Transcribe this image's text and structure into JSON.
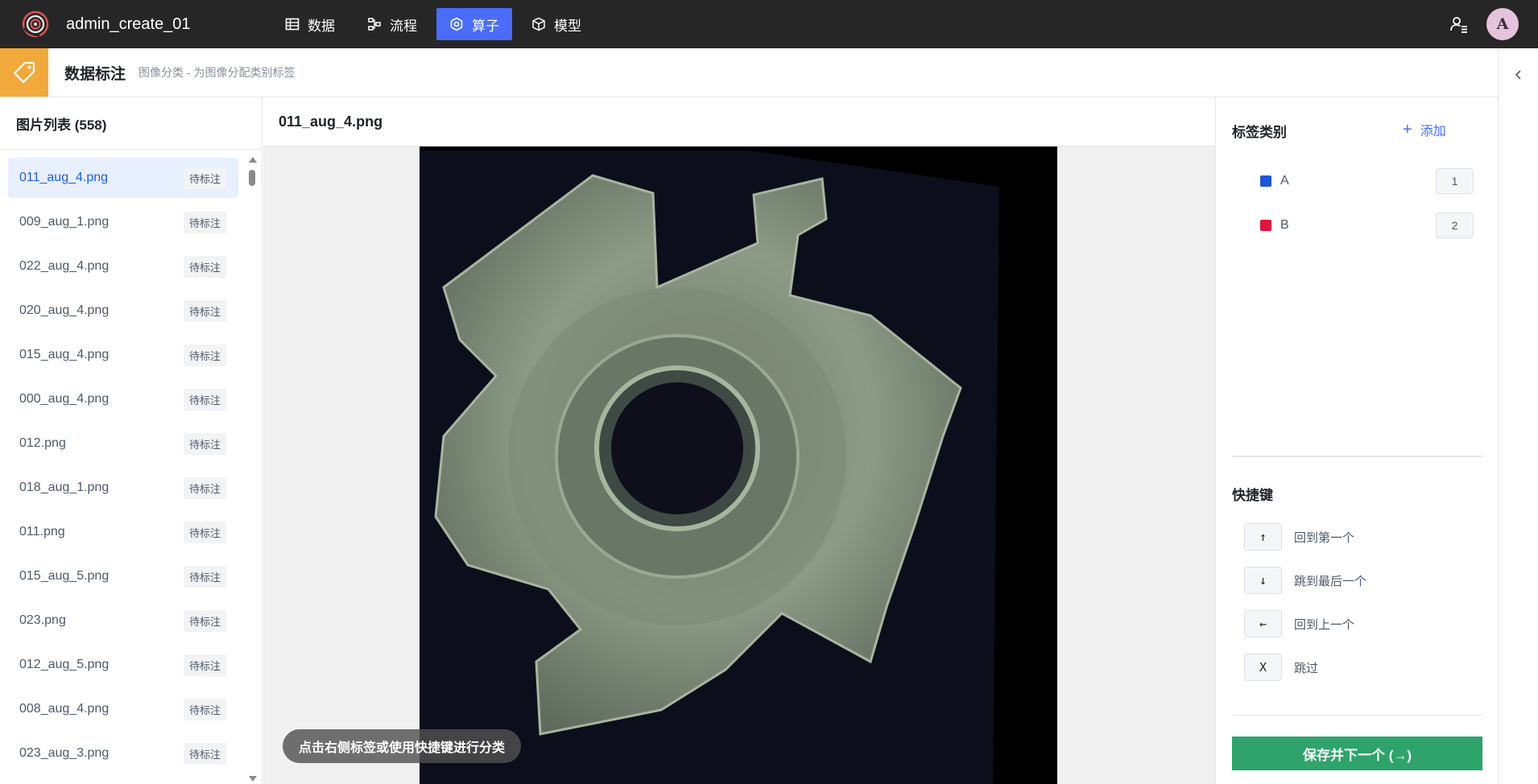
{
  "app": {
    "title": "admin_create_01",
    "avatar_letter": "A",
    "logo_icon": "spiral-logo",
    "user_menu_icon": "user-list-icon"
  },
  "nav": {
    "items": [
      {
        "label": "数据",
        "icon": "table-icon",
        "active": false
      },
      {
        "label": "流程",
        "icon": "flow-icon",
        "active": false
      },
      {
        "label": "算子",
        "icon": "hexagon-gear-icon",
        "active": true
      },
      {
        "label": "模型",
        "icon": "cube-icon",
        "active": false
      }
    ],
    "active_color": "#4a6cf7"
  },
  "header": {
    "title": "数据标注",
    "subtitle": "图像分类 - 为图像分配类别标签",
    "tag_icon_bg": "#f2a93b"
  },
  "left_panel": {
    "title": "图片列表 (558)",
    "files": [
      {
        "name": "011_aug_4.png",
        "status": "待标注",
        "selected": true
      },
      {
        "name": "009_aug_1.png",
        "status": "待标注",
        "selected": false
      },
      {
        "name": "022_aug_4.png",
        "status": "待标注",
        "selected": false
      },
      {
        "name": "020_aug_4.png",
        "status": "待标注",
        "selected": false
      },
      {
        "name": "015_aug_4.png",
        "status": "待标注",
        "selected": false
      },
      {
        "name": "000_aug_4.png",
        "status": "待标注",
        "selected": false
      },
      {
        "name": "012.png",
        "status": "待标注",
        "selected": false
      },
      {
        "name": "018_aug_1.png",
        "status": "待标注",
        "selected": false
      },
      {
        "name": "011.png",
        "status": "待标注",
        "selected": false
      },
      {
        "name": "015_aug_5.png",
        "status": "待标注",
        "selected": false
      },
      {
        "name": "023.png",
        "status": "待标注",
        "selected": false
      },
      {
        "name": "012_aug_5.png",
        "status": "待标注",
        "selected": false
      },
      {
        "name": "008_aug_4.png",
        "status": "待标注",
        "selected": false
      },
      {
        "name": "023_aug_3.png",
        "status": "待标注",
        "selected": false
      }
    ]
  },
  "center": {
    "filename": "011_aug_4.png",
    "hint": "点击右侧标签或使用快捷键进行分类"
  },
  "right_panel": {
    "labels_title": "标签类别",
    "add_label": "添加",
    "labels": [
      {
        "name": "A",
        "color": "#1b56d6",
        "key": "1"
      },
      {
        "name": "B",
        "color": "#e0143f",
        "key": "2"
      }
    ],
    "shortcuts_title": "快捷键",
    "shortcuts": [
      {
        "key": "↑",
        "label": "回到第一个"
      },
      {
        "key": "↓",
        "label": "跳到最后一个"
      },
      {
        "key": "←",
        "label": "回到上一个"
      },
      {
        "key": "X",
        "label": "跳过"
      }
    ],
    "save_label": "保存并下一个 (→)",
    "save_color": "#2ea36b"
  }
}
